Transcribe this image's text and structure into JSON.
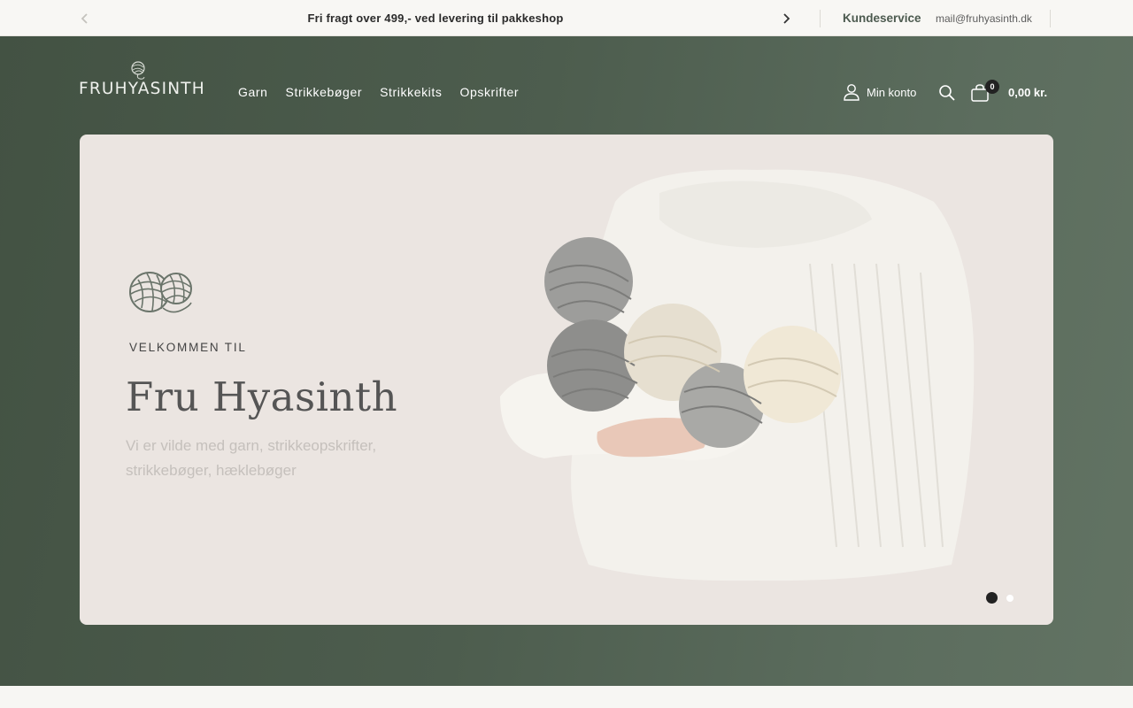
{
  "announcement": {
    "message": "Fri fragt over 499,- ved levering til pakkeshop",
    "prev_icon": "chevron-left-icon",
    "next_icon": "chevron-right-icon"
  },
  "topbar": {
    "service_label": "Kundeservice",
    "email": "mail@fruhyasinth.dk"
  },
  "header": {
    "logo_text": "FRUHYASINTH",
    "nav": [
      {
        "label": "Garn"
      },
      {
        "label": "Strikkebøger"
      },
      {
        "label": "Strikkekits"
      },
      {
        "label": "Opskrifter"
      }
    ],
    "account_label": "Min konto",
    "cart_count": "0",
    "cart_total": "0,00 kr."
  },
  "hero": {
    "eyebrow": "VELKOMMEN TIL",
    "title": "Fru Hyasinth",
    "subtitle": "Vi er vilde med garn, strikkeopskrifter, strikkebøger, hæklebøger",
    "slide_count": 2,
    "active_slide": 1
  },
  "colors": {
    "header_green": "#4d5d4e",
    "card_bg": "#ebe5e1",
    "accent_text": "#4c5a4f"
  }
}
